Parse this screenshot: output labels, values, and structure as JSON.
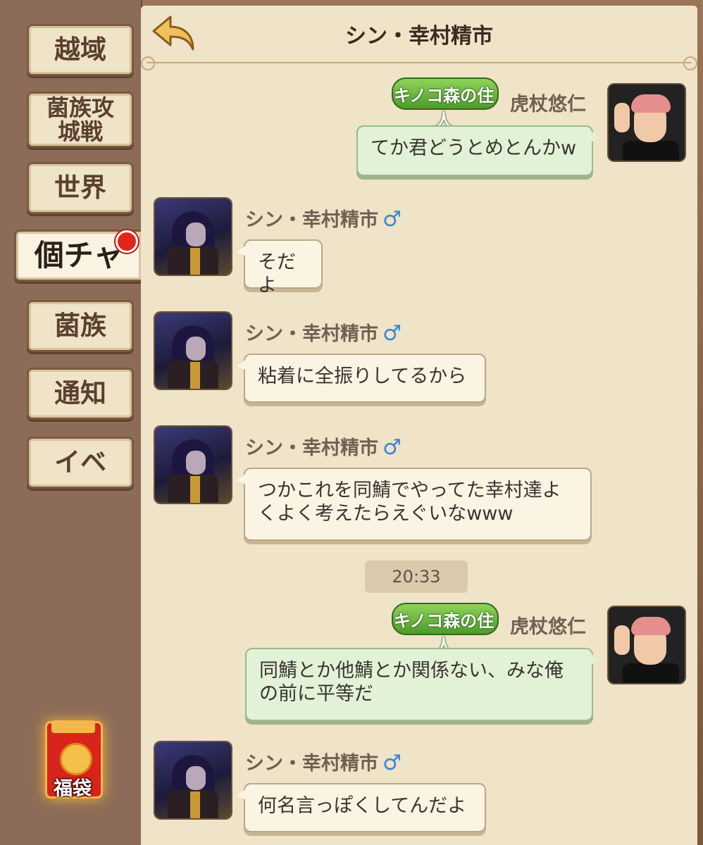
{
  "sidebar": {
    "tabs": [
      {
        "label": "越域"
      },
      {
        "label": "菌族攻城戦"
      },
      {
        "label": "世界"
      },
      {
        "label": "個チャ"
      },
      {
        "label": "菌族"
      },
      {
        "label": "通知"
      },
      {
        "label": "イベ"
      }
    ],
    "fukubukuro": {
      "label": "福袋"
    }
  },
  "header": {
    "title": "シン・幸村精市"
  },
  "messages": [
    {
      "sender": "虎杖悠仁",
      "badge": "キノコ森の住人",
      "text": "てか君どうとめとんかw"
    },
    {
      "sender": "シン・幸村精市",
      "gender": "♂",
      "text": "そだよ"
    },
    {
      "sender": "シン・幸村精市",
      "gender": "♂",
      "text": "粘着に全振りしてるから"
    },
    {
      "sender": "シン・幸村精市",
      "gender": "♂",
      "text": "つかこれを同鯖でやってた幸村達よくよく考えたらえぐいなwww"
    },
    {
      "sender": "虎杖悠仁",
      "badge": "キノコ森の住人",
      "text": "同鯖とか他鯖とか関係ない、みな俺の前に平等だ"
    },
    {
      "sender": "シン・幸村精市",
      "gender": "♂",
      "text": "何名言っぽくしてんだよ"
    }
  ],
  "timestamp": "20:33"
}
